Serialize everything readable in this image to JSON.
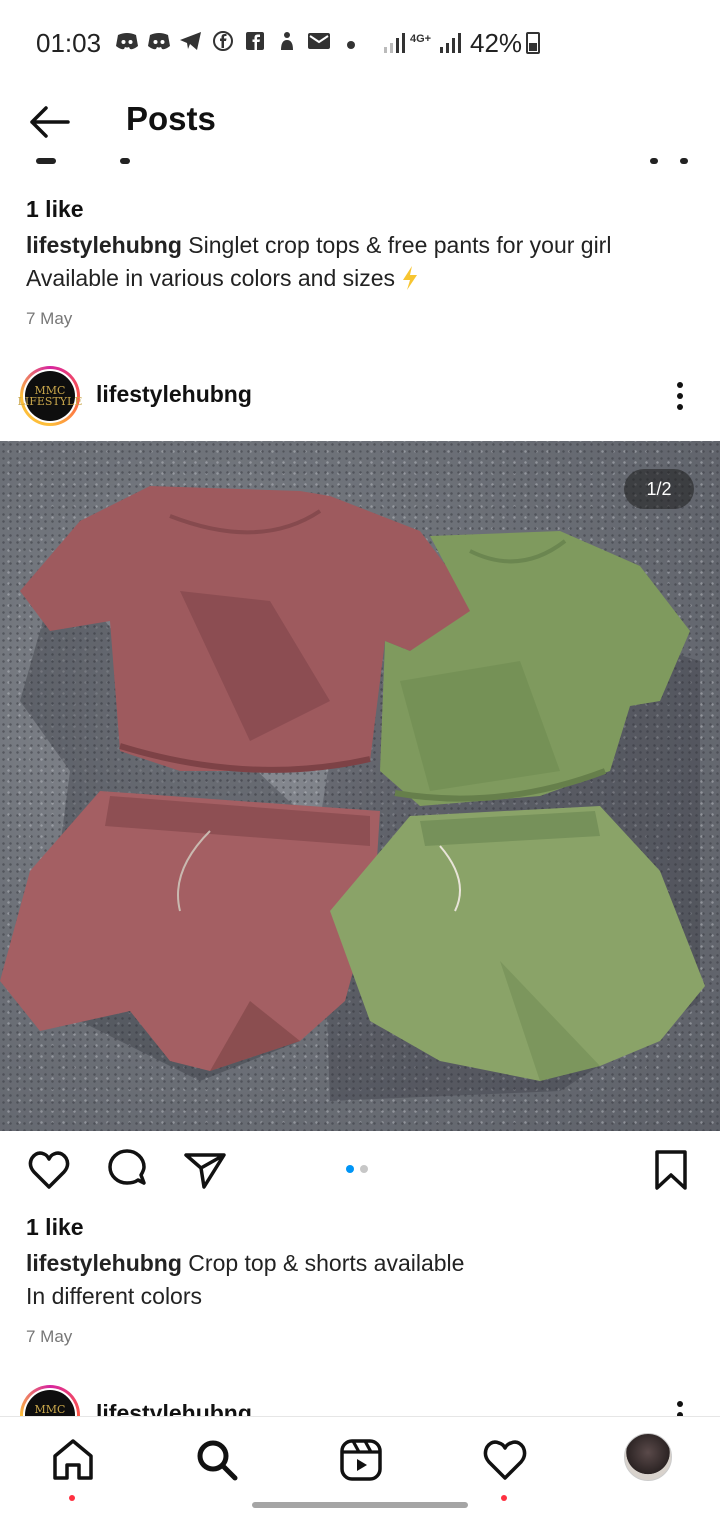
{
  "status_bar": {
    "time": "01:03",
    "network": "4G+",
    "battery": "42%",
    "notification_icons": [
      "discord-icon",
      "discord-icon",
      "telegram-icon",
      "facebook-icon",
      "facebook-icon",
      "app-icon",
      "mail-icon"
    ]
  },
  "header": {
    "title": "Posts"
  },
  "previous_post": {
    "likes": "1 like",
    "username": "lifestylehubng",
    "caption_line1": "Singlet crop tops & free pants for your girl",
    "caption_line2": "Available in various colors and sizes",
    "date": "7 May"
  },
  "post": {
    "username": "lifestylehubng",
    "avatar_text": "MMC LIFESTYLE",
    "image_counter": "1/2",
    "likes": "1 like",
    "caption_line1": "Crop top & shorts available",
    "caption_line2": "In different colors",
    "date": "7 May",
    "carousel_total": 2,
    "carousel_active": 1
  },
  "next_post": {
    "username": "lifestylehubng"
  },
  "bottom_nav": {
    "items": [
      "home-icon",
      "search-icon",
      "reels-icon",
      "activity-icon",
      "profile-avatar"
    ]
  },
  "colors": {
    "accent": "#0095f6",
    "notification": "#ff3040",
    "text": "#111111",
    "muted": "#777777"
  }
}
